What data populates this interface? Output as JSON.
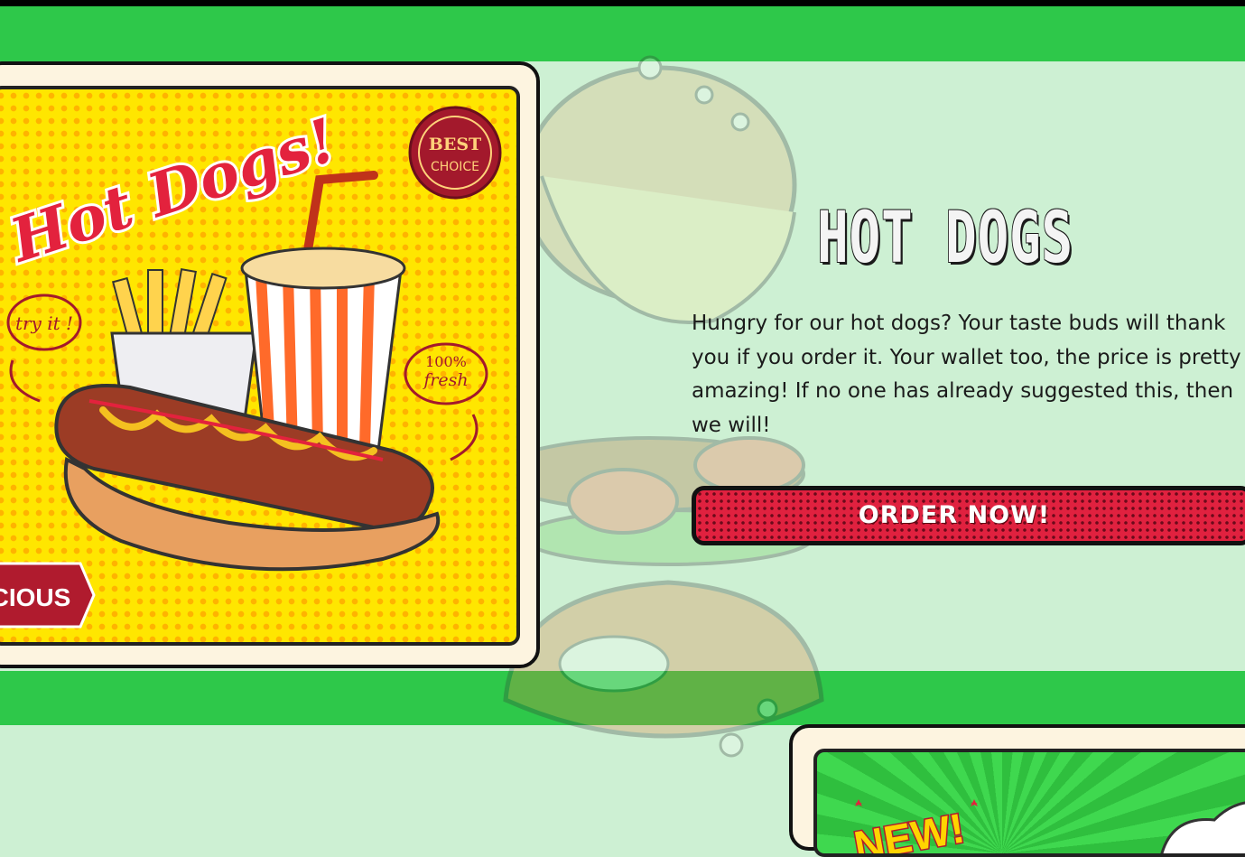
{
  "hero": {
    "title": "HOT DOGS",
    "description": "Hungry for our hot dogs? Your taste buds will thank you if you order it. Your wallet too, the price is pretty amazing! If no one has already suggested this, then we will!",
    "cta_label": "ORDER NOW!"
  },
  "poster": {
    "headline": "Hot Dogs!",
    "badge_line1": "BEST",
    "badge_line2": "CHOICE",
    "try_it": "try it !",
    "fresh_line1": "100%",
    "fresh_line2": "fresh",
    "ribbon": "CIOUS"
  },
  "next_card": {
    "badge": "NEW!"
  },
  "colors": {
    "band_green": "#2ec84a",
    "section_bg": "#cdf0d3",
    "cta_red": "#e0213f",
    "poster_yellow": "#ffe600"
  }
}
